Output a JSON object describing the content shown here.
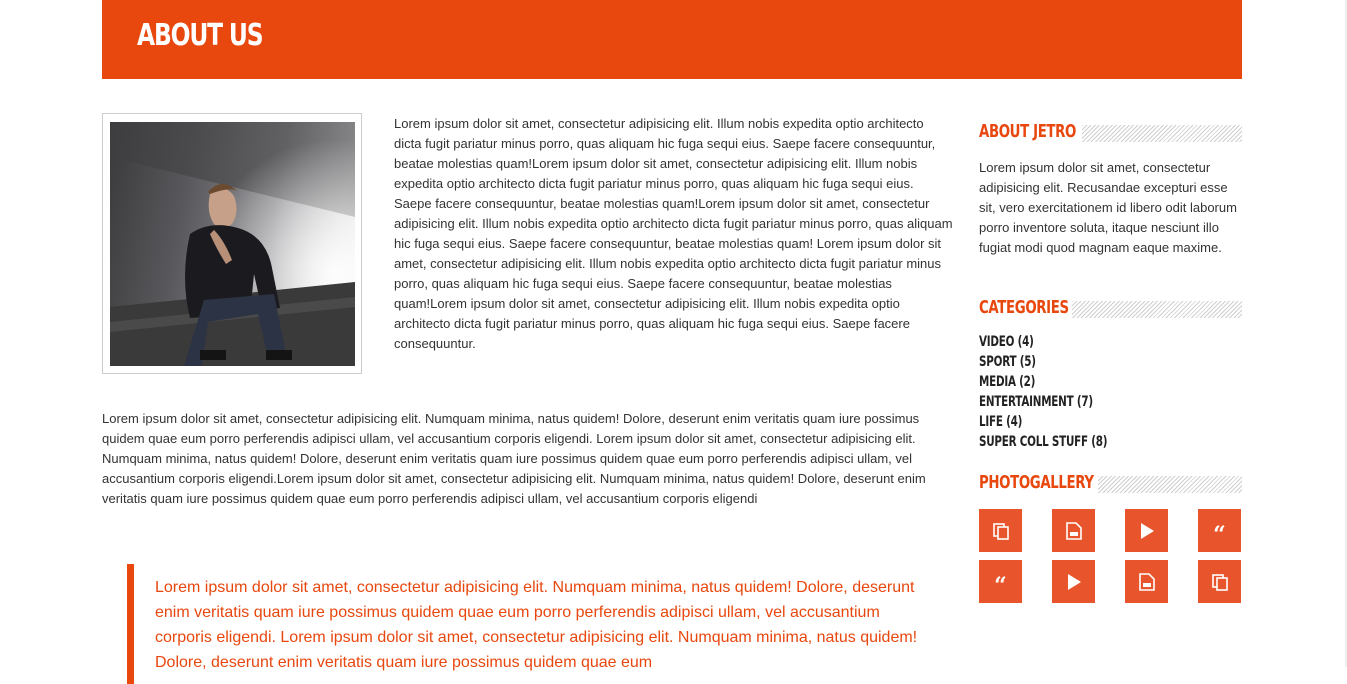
{
  "page_title": "ABOUT US",
  "intro_text": "Lorem ipsum dolor sit amet, consectetur adipisicing elit. Illum nobis expedita optio architecto dicta fugit pariatur minus porro, quas aliquam hic fuga sequi eius. Saepe facere consequuntur, beatae molestias quam!Lorem ipsum dolor sit amet, consectetur adipisicing elit. Illum nobis expedita optio architecto dicta fugit pariatur minus porro, quas aliquam hic fuga sequi eius. Saepe facere consequuntur, beatae molestias quam!Lorem ipsum dolor sit amet, consectetur adipisicing elit. Illum nobis expedita optio architecto dicta fugit pariatur minus porro, quas aliquam hic fuga sequi eius. Saepe facere consequuntur, beatae molestias quam! Lorem ipsum dolor sit amet, consectetur adipisicing elit. Illum nobis expedita optio architecto dicta fugit pariatur minus porro, quas aliquam hic fuga sequi eius. Saepe facere consequuntur, beatae molestias quam!Lorem ipsum dolor sit amet, consectetur adipisicing elit. Illum nobis expedita optio architecto dicta fugit pariatur minus porro, quas aliquam hic fuga sequi eius. Saepe facere consequuntur.",
  "body_text": "Lorem ipsum dolor sit amet, consectetur adipisicing elit. Numquam minima, natus quidem! Dolore, deserunt enim veritatis quam iure possimus quidem quae eum porro perferendis adipisci ullam, vel accusantium corporis eligendi. Lorem ipsum dolor sit amet, consectetur adipisicing elit. Numquam minima, natus quidem! Dolore, deserunt enim veritatis quam iure possimus quidem quae eum porro perferendis adipisci ullam, vel accusantium corporis eligendi.Lorem ipsum dolor sit amet, consectetur adipisicing elit. Numquam minima, natus quidem! Dolore, deserunt enim veritatis quam iure possimus quidem quae eum porro perferendis adipisci ullam, vel accusantium corporis eligendi",
  "blockquote_text": "Lorem ipsum dolor sit amet, consectetur adipisicing elit. Numquam minima, natus quidem! Dolore, deserunt enim veritatis quam iure possimus quidem quae eum porro perferendis adipisci ullam, vel accusantium corporis eligendi. Lorem ipsum dolor sit amet, consectetur adipisicing elit. Numquam minima, natus quidem! Dolore, deserunt enim veritatis quam iure possimus quidem quae eum",
  "sidebar": {
    "about": {
      "title": "ABOUT JETRO",
      "text": "Lorem ipsum dolor sit amet, consectetur adipisicing elit. Recusandae excepturi esse sit, vero exercitationem id libero odit laborum porro inventore soluta, itaque nesciunt illo fugiat modi quod magnam eaque maxime."
    },
    "categories": {
      "title": "CATEGORIES",
      "items": [
        {
          "label": "VIDEO (4)"
        },
        {
          "label": "SPORT (5)"
        },
        {
          "label": "MEDIA (2)"
        },
        {
          "label": "ENTERTAINMENT (7)"
        },
        {
          "label": "LIFE (4)"
        },
        {
          "label": "SUPER COLL STUFF (8)"
        }
      ]
    },
    "gallery": {
      "title": "PHOTOGALLERY",
      "tiles": [
        "copy-icon",
        "document-icon",
        "play-icon",
        "quote-icon",
        "quote-icon",
        "play-icon",
        "document-icon",
        "copy-icon"
      ]
    }
  },
  "colors": {
    "accent": "#e8470e",
    "tile": "#e8552c",
    "text": "#333333"
  }
}
